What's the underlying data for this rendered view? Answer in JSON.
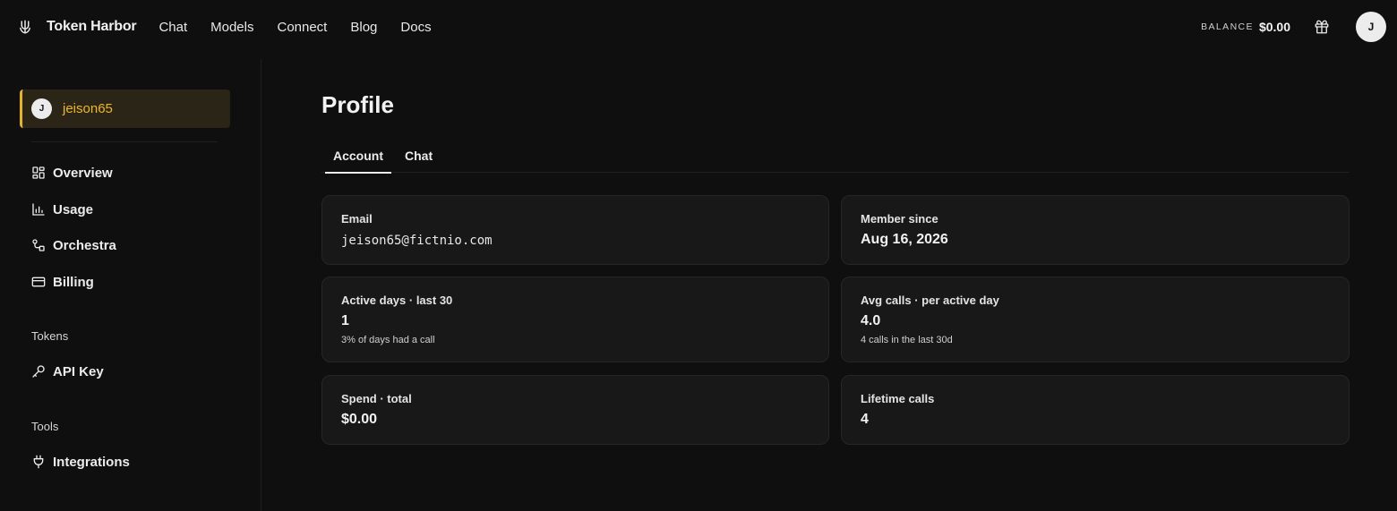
{
  "header": {
    "brand": "Token Harbor",
    "brand_icon": "anchor-icon",
    "nav": [
      "Chat",
      "Models",
      "Connect",
      "Blog",
      "Docs"
    ],
    "balance_label": "BALANCE",
    "balance_value": "$0.00",
    "gift_icon": "gift-icon",
    "avatar_initial": "J"
  },
  "sidebar": {
    "user": {
      "initial": "J",
      "name": "jeison65"
    },
    "items": [
      {
        "label": "Overview",
        "icon": "grid-icon"
      },
      {
        "label": "Usage",
        "icon": "bar-chart-icon"
      },
      {
        "label": "Orchestra",
        "icon": "workflow-icon"
      },
      {
        "label": "Billing",
        "icon": "credit-card-icon"
      }
    ],
    "sections": [
      {
        "title": "Tokens",
        "items": [
          {
            "label": "API Key",
            "icon": "key-icon"
          }
        ]
      },
      {
        "title": "Tools",
        "items": [
          {
            "label": "Integrations",
            "icon": "plug-icon"
          }
        ]
      }
    ],
    "accent": "#e8b417"
  },
  "main": {
    "title": "Profile",
    "tabs": [
      "Account",
      "Chat"
    ],
    "active_tab": "Account",
    "cards": {
      "email": {
        "label": "Email",
        "value": "jeison65@fictnio.com"
      },
      "member_since": {
        "label": "Member since",
        "value": "Aug 16, 2026"
      },
      "active_days": {
        "label": "Active days · last 30",
        "value": "1",
        "sub": "3% of days had a call"
      },
      "avg_calls": {
        "label": "Avg calls · per active day",
        "value": "4.0",
        "sub": "4 calls in the last 30d"
      },
      "spend": {
        "label": "Spend · total",
        "value": "$0.00"
      },
      "lifetime": {
        "label": "Lifetime calls",
        "value": "4"
      }
    }
  }
}
